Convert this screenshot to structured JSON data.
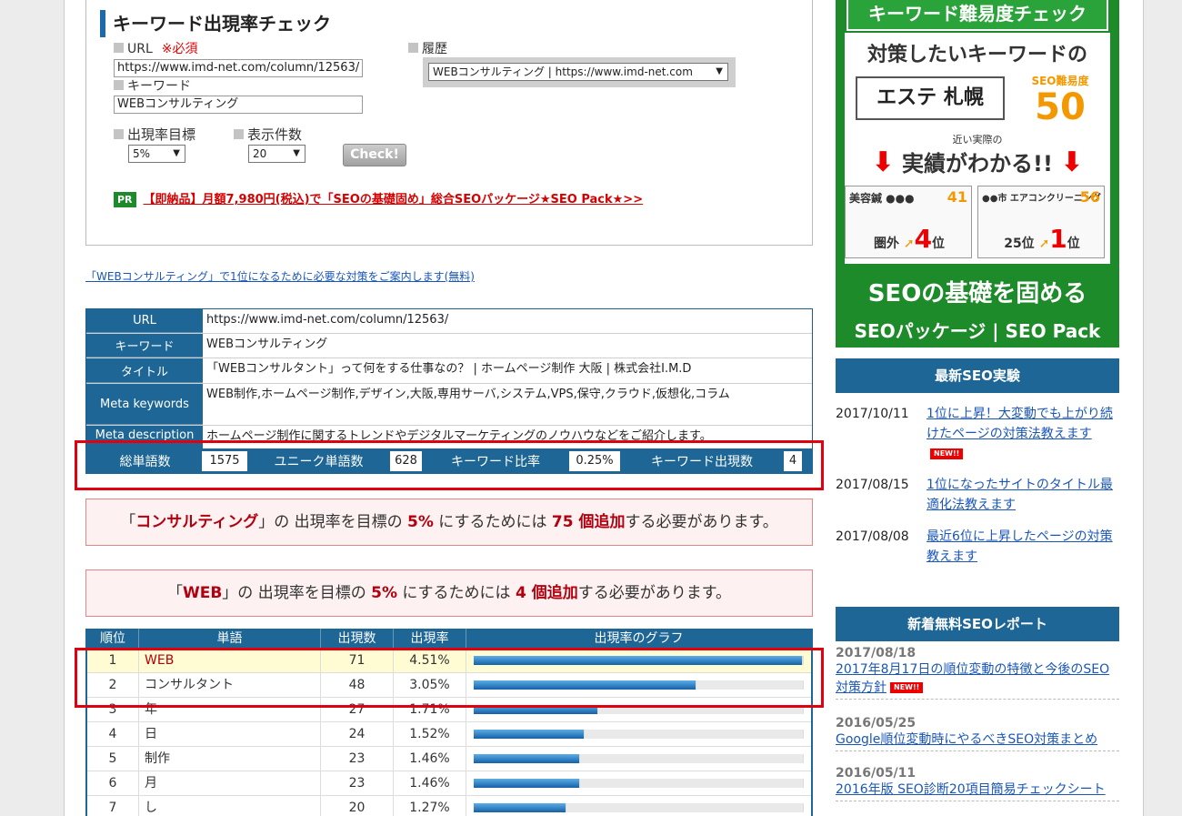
{
  "form": {
    "title": "キーワード出現率チェック",
    "url_label": "URL",
    "required_label": "※必須",
    "url_value": "https://www.imd-net.com/column/12563/",
    "keyword_label": "キーワード",
    "keyword_value": "WEBコンサルティング",
    "history_label": "履歴",
    "history_value": "WEBコンサルティング | https://www.imd-net.com",
    "target_label": "出現率目標",
    "target_value": "5%",
    "count_label": "表示件数",
    "count_value": "20",
    "check_button": "Check!",
    "pr_badge": "PR",
    "pr_text": "【即納品】月額7,980円(税込)で「SEOの基礎固め」総合SEOパッケージ★SEO Pack★>>"
  },
  "guide_link": "「WEBコンサルティング」で1位になるために必要な対策をご案内します(無料)",
  "info": {
    "rows": [
      {
        "label": "URL",
        "value": "https://www.imd-net.com/column/12563/"
      },
      {
        "label": "キーワード",
        "value": "WEBコンサルティング"
      },
      {
        "label": "タイトル",
        "value": "「WEBコンサルタント」って何をする仕事なの？ | ホームページ制作 大阪 | 株式会社I.M.D"
      },
      {
        "label": "Meta keywords",
        "value": "WEB制作,ホームページ制作,デザイン,大阪,専用サーバ,システム,VPS,保守,クラウド,仮想化,コラム"
      },
      {
        "label": "Meta description",
        "value": "ホームページ制作に関するトレンドやデジタルマーケティングのノウハウなどをご紹介します。"
      }
    ]
  },
  "stats": {
    "total_label": "総単語数",
    "total_value": "1575",
    "unique_label": "ユニーク単語数",
    "unique_value": "628",
    "ratio_label": "キーワード比率",
    "ratio_value": "0.25%",
    "count_label": "キーワード出現数",
    "count_value": "4"
  },
  "messages": [
    {
      "pre": "「",
      "word": "コンサルティング",
      "mid1": "」の 出現率を目標の ",
      "pct": "5%",
      "mid2": " にするためには ",
      "num": "75 個追加",
      "post": "する必要があります。"
    },
    {
      "pre": "「",
      "word": "WEB",
      "mid1": "」の 出現率を目標の ",
      "pct": "5%",
      "mid2": " にするためには ",
      "num": "4 個追加",
      "post": "する必要があります。"
    }
  ],
  "rank": {
    "headers": [
      "順位",
      "単語",
      "出現数",
      "出現率",
      "出現率のグラフ"
    ],
    "rows": [
      {
        "rank": "1",
        "word": "WEB",
        "count": "71",
        "rate": "4.51%",
        "value": 4.51,
        "highlight": true
      },
      {
        "rank": "2",
        "word": "コンサルタント",
        "count": "48",
        "rate": "3.05%",
        "value": 3.05,
        "highlight": false
      },
      {
        "rank": "3",
        "word": "年",
        "count": "27",
        "rate": "1.71%",
        "value": 1.71,
        "highlight": false
      },
      {
        "rank": "4",
        "word": "日",
        "count": "24",
        "rate": "1.52%",
        "value": 1.52,
        "highlight": false
      },
      {
        "rank": "5",
        "word": "制作",
        "count": "23",
        "rate": "1.46%",
        "value": 1.46,
        "highlight": false
      },
      {
        "rank": "6",
        "word": "月",
        "count": "23",
        "rate": "1.46%",
        "value": 1.46,
        "highlight": false
      },
      {
        "rank": "7",
        "word": "し",
        "count": "20",
        "rate": "1.27%",
        "value": 1.27,
        "highlight": false
      }
    ]
  },
  "banner": {
    "title": "キーワード難易度チェック",
    "tagline": "対策したいキーワードの",
    "keyword": "エステ 札幌",
    "score_label": "SEO難易度",
    "score": "50",
    "mid_small": "近い実際の",
    "mid_text": "実績がわかる!!",
    "case1": {
      "name": "美容鍼 ●●●",
      "score": "41",
      "from": "圏外",
      "to": "4",
      "unit": "位"
    },
    "case2": {
      "name": "●●市 エアコンクリーニング",
      "score": "56",
      "from": "25位",
      "to": "1",
      "unit": "位"
    },
    "foot1": "SEOの基礎を固める",
    "foot2": "SEOパッケージ | SEO Pack"
  },
  "latest": {
    "heading": "最新SEO実験",
    "new_label": "NEW!!",
    "items": [
      {
        "date": "2017/10/11",
        "title": "1位に上昇！大変動でも上がり続けたページの対策法教えます"
      },
      {
        "date": "2017/08/15",
        "title": "1位になったサイトのタイトル最適化法教えます"
      },
      {
        "date": "2017/08/08",
        "title": "最近6位に上昇したページの対策教えます"
      }
    ]
  },
  "reports": {
    "heading": "新着無料SEOレポート",
    "items": [
      {
        "date": "2017/08/18",
        "title": "2017年8月17日の順位変動の特徴と今後のSEO対策方針"
      },
      {
        "date": "2016/05/25",
        "title": "Google順位変動時にやるべきSEO対策まとめ"
      },
      {
        "date": "2016/05/11",
        "title": "2016年版 SEO診断20項目簡易チェックシート"
      }
    ]
  },
  "colors": {
    "accent": "#1d6696",
    "alert": "#e00010",
    "bar": "#1560a8"
  },
  "chart_data": {
    "type": "bar",
    "title": "出現率のグラフ",
    "categories": [
      "WEB",
      "コンサルタント",
      "年",
      "日",
      "制作",
      "月",
      "し"
    ],
    "values": [
      4.51,
      3.05,
      1.71,
      1.52,
      1.46,
      1.46,
      1.27
    ]
  }
}
